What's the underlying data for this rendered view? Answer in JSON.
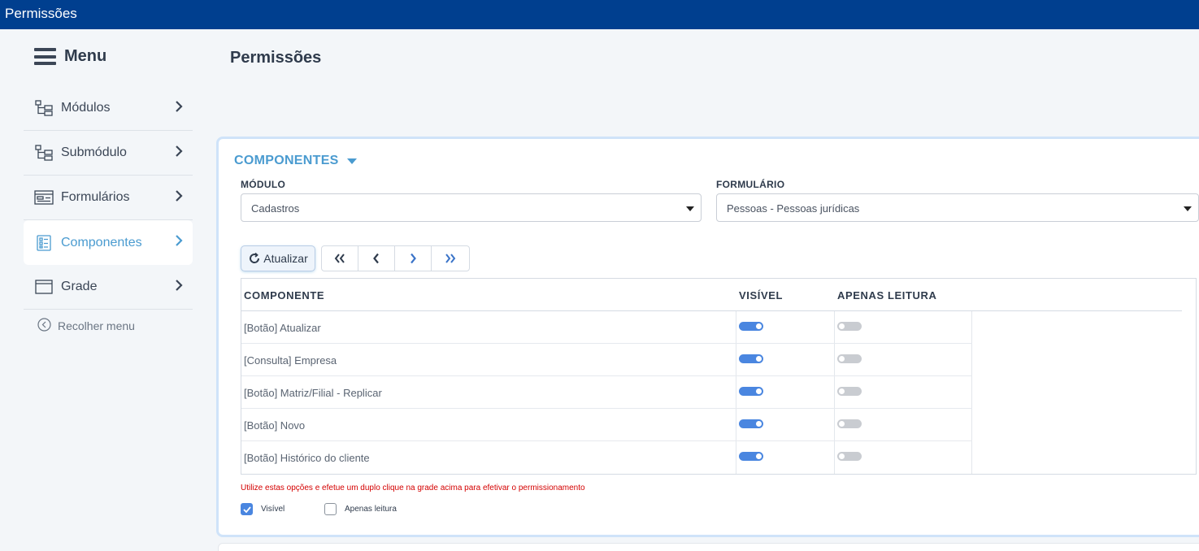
{
  "window": {
    "title": "Permissões"
  },
  "sidebar": {
    "title": "Menu",
    "items": [
      {
        "label": "Módulos",
        "icon": "hierarchy-icon",
        "active": false
      },
      {
        "label": "Submódulo",
        "icon": "hierarchy-icon",
        "active": false
      },
      {
        "label": "Formulários",
        "icon": "form-icon",
        "active": false
      },
      {
        "label": "Componentes",
        "icon": "checklist-icon",
        "active": true
      },
      {
        "label": "Grade",
        "icon": "window-icon",
        "active": false
      }
    ],
    "collapse_label": "Recolher menu"
  },
  "page": {
    "title": "Permissões"
  },
  "section": {
    "title": "COMPONENTES",
    "modulo_label": "MÓDULO",
    "modulo_value": "Cadastros",
    "formulario_label": "FORMULÁRIO",
    "formulario_value": "Pessoas - Pessoas jurídicas",
    "refresh_label": "Atualizar"
  },
  "grid": {
    "columns": [
      "COMPONENTE",
      "VISÍVEL",
      "APENAS LEITURA"
    ],
    "rows": [
      {
        "name": "[Botão] Atualizar",
        "visible": true,
        "readonly": false
      },
      {
        "name": "[Consulta] Empresa",
        "visible": true,
        "readonly": false
      },
      {
        "name": "[Botão] Matriz/Filial - Replicar",
        "visible": true,
        "readonly": false
      },
      {
        "name": "[Botão] Novo",
        "visible": true,
        "readonly": false
      },
      {
        "name": "[Botão] Histórico do cliente",
        "visible": true,
        "readonly": false
      }
    ]
  },
  "footer": {
    "hint": "Utilize estas opções e efetue um duplo clique na grade acima para efetivar o permissionamento",
    "visible_label": "Visível",
    "visible_checked": true,
    "readonly_label": "Apenas leitura",
    "readonly_checked": false
  },
  "colors": {
    "titlebar": "#003f8f",
    "accent": "#4a9bd0",
    "toggle_on": "#4a86e0",
    "hint": "#d40000"
  }
}
